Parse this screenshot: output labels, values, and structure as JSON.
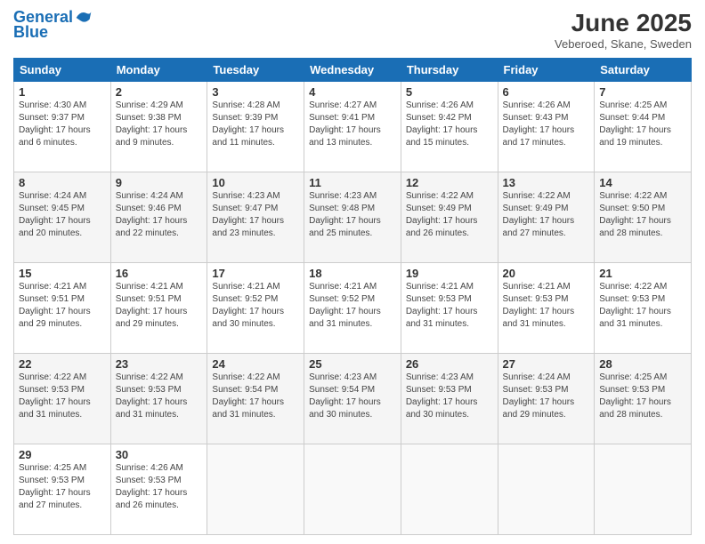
{
  "header": {
    "logo_line1": "General",
    "logo_line2": "Blue",
    "month_title": "June 2025",
    "location": "Veberoed, Skane, Sweden"
  },
  "days_of_week": [
    "Sunday",
    "Monday",
    "Tuesday",
    "Wednesday",
    "Thursday",
    "Friday",
    "Saturday"
  ],
  "weeks": [
    [
      {
        "day": "1",
        "sunrise": "4:30 AM",
        "sunset": "9:37 PM",
        "daylight": "17 hours and 6 minutes."
      },
      {
        "day": "2",
        "sunrise": "4:29 AM",
        "sunset": "9:38 PM",
        "daylight": "17 hours and 9 minutes."
      },
      {
        "day": "3",
        "sunrise": "4:28 AM",
        "sunset": "9:39 PM",
        "daylight": "17 hours and 11 minutes."
      },
      {
        "day": "4",
        "sunrise": "4:27 AM",
        "sunset": "9:41 PM",
        "daylight": "17 hours and 13 minutes."
      },
      {
        "day": "5",
        "sunrise": "4:26 AM",
        "sunset": "9:42 PM",
        "daylight": "17 hours and 15 minutes."
      },
      {
        "day": "6",
        "sunrise": "4:26 AM",
        "sunset": "9:43 PM",
        "daylight": "17 hours and 17 minutes."
      },
      {
        "day": "7",
        "sunrise": "4:25 AM",
        "sunset": "9:44 PM",
        "daylight": "17 hours and 19 minutes."
      }
    ],
    [
      {
        "day": "8",
        "sunrise": "4:24 AM",
        "sunset": "9:45 PM",
        "daylight": "17 hours and 20 minutes."
      },
      {
        "day": "9",
        "sunrise": "4:24 AM",
        "sunset": "9:46 PM",
        "daylight": "17 hours and 22 minutes."
      },
      {
        "day": "10",
        "sunrise": "4:23 AM",
        "sunset": "9:47 PM",
        "daylight": "17 hours and 23 minutes."
      },
      {
        "day": "11",
        "sunrise": "4:23 AM",
        "sunset": "9:48 PM",
        "daylight": "17 hours and 25 minutes."
      },
      {
        "day": "12",
        "sunrise": "4:22 AM",
        "sunset": "9:49 PM",
        "daylight": "17 hours and 26 minutes."
      },
      {
        "day": "13",
        "sunrise": "4:22 AM",
        "sunset": "9:49 PM",
        "daylight": "17 hours and 27 minutes."
      },
      {
        "day": "14",
        "sunrise": "4:22 AM",
        "sunset": "9:50 PM",
        "daylight": "17 hours and 28 minutes."
      }
    ],
    [
      {
        "day": "15",
        "sunrise": "4:21 AM",
        "sunset": "9:51 PM",
        "daylight": "17 hours and 29 minutes."
      },
      {
        "day": "16",
        "sunrise": "4:21 AM",
        "sunset": "9:51 PM",
        "daylight": "17 hours and 29 minutes."
      },
      {
        "day": "17",
        "sunrise": "4:21 AM",
        "sunset": "9:52 PM",
        "daylight": "17 hours and 30 minutes."
      },
      {
        "day": "18",
        "sunrise": "4:21 AM",
        "sunset": "9:52 PM",
        "daylight": "17 hours and 31 minutes."
      },
      {
        "day": "19",
        "sunrise": "4:21 AM",
        "sunset": "9:53 PM",
        "daylight": "17 hours and 31 minutes."
      },
      {
        "day": "20",
        "sunrise": "4:21 AM",
        "sunset": "9:53 PM",
        "daylight": "17 hours and 31 minutes."
      },
      {
        "day": "21",
        "sunrise": "4:22 AM",
        "sunset": "9:53 PM",
        "daylight": "17 hours and 31 minutes."
      }
    ],
    [
      {
        "day": "22",
        "sunrise": "4:22 AM",
        "sunset": "9:53 PM",
        "daylight": "17 hours and 31 minutes."
      },
      {
        "day": "23",
        "sunrise": "4:22 AM",
        "sunset": "9:53 PM",
        "daylight": "17 hours and 31 minutes."
      },
      {
        "day": "24",
        "sunrise": "4:22 AM",
        "sunset": "9:54 PM",
        "daylight": "17 hours and 31 minutes."
      },
      {
        "day": "25",
        "sunrise": "4:23 AM",
        "sunset": "9:54 PM",
        "daylight": "17 hours and 30 minutes."
      },
      {
        "day": "26",
        "sunrise": "4:23 AM",
        "sunset": "9:53 PM",
        "daylight": "17 hours and 30 minutes."
      },
      {
        "day": "27",
        "sunrise": "4:24 AM",
        "sunset": "9:53 PM",
        "daylight": "17 hours and 29 minutes."
      },
      {
        "day": "28",
        "sunrise": "4:25 AM",
        "sunset": "9:53 PM",
        "daylight": "17 hours and 28 minutes."
      }
    ],
    [
      {
        "day": "29",
        "sunrise": "4:25 AM",
        "sunset": "9:53 PM",
        "daylight": "17 hours and 27 minutes."
      },
      {
        "day": "30",
        "sunrise": "4:26 AM",
        "sunset": "9:53 PM",
        "daylight": "17 hours and 26 minutes."
      },
      null,
      null,
      null,
      null,
      null
    ]
  ]
}
